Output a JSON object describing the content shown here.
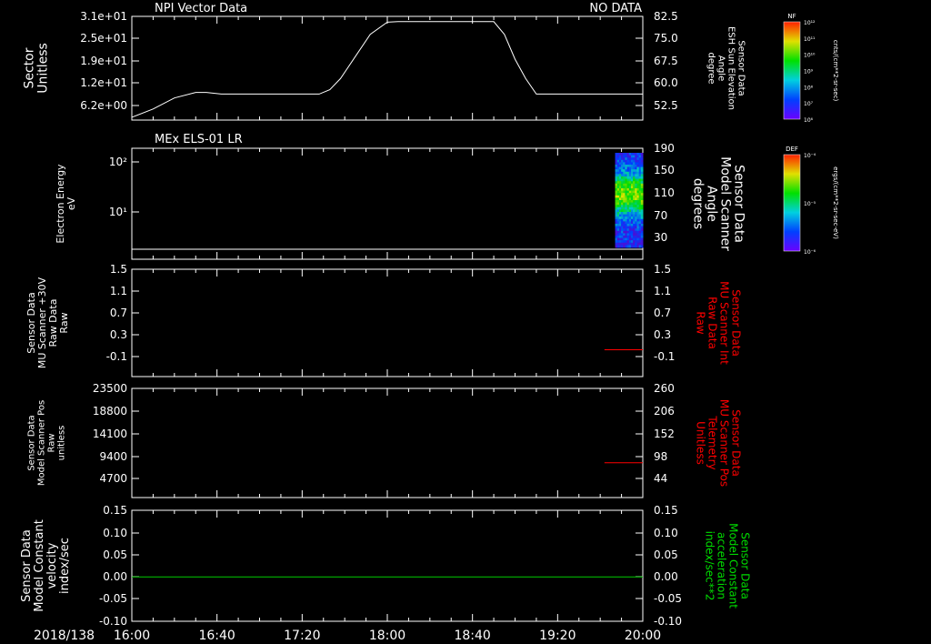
{
  "header": {
    "left_title": "NPI Vector Data",
    "right_title": "NO DATA"
  },
  "footer": {
    "date_label": "2018/138"
  },
  "colorbars": [
    {
      "label": "NF",
      "units": "cnts/(cm**2-sr-sec)",
      "ticks": [
        "10¹²",
        "10¹¹",
        "10¹⁰",
        "10⁹",
        "10⁸",
        "10⁷",
        "10⁶"
      ]
    },
    {
      "label": "DEF",
      "units": "ergs/(cm**2-sr-sec-eV)",
      "ticks": [
        "10⁻⁴",
        "10⁻⁵",
        "10⁻⁶"
      ]
    }
  ],
  "chart_data": [
    {
      "type": "line",
      "panel": 1,
      "left_ylabel": [
        "Sector",
        "Unitless"
      ],
      "left_ticks": [
        "3.1e+01",
        "2.5e+01",
        "1.9e+01",
        "1.2e+01",
        "6.2e+00"
      ],
      "right_ylabel": [
        "Sensor Data",
        "ESH Sun Elevation",
        "Angle",
        "degree"
      ],
      "right_ticks": [
        "82.5",
        "75.0",
        "67.5",
        "60.0",
        "52.5"
      ],
      "xlim": [
        0,
        240
      ],
      "ylim": [
        45,
        82.5
      ],
      "series": [
        {
          "color": "#ffffff",
          "x": [
            0,
            10,
            20,
            30,
            35,
            42,
            50,
            60,
            70,
            80,
            88,
            93,
            98,
            105,
            112,
            120,
            125,
            130,
            135,
            140,
            145,
            150,
            155,
            160,
            165,
            170,
            175,
            180,
            185,
            190,
            195,
            200,
            210,
            220,
            230,
            240
          ],
          "y": [
            46,
            49,
            53,
            55,
            55,
            54.4,
            54.4,
            54.4,
            54.4,
            54.4,
            54.4,
            56,
            60,
            68,
            76,
            80.4,
            80.6,
            80.6,
            80.6,
            80.6,
            80.6,
            80.6,
            80.6,
            80.6,
            80.6,
            80.6,
            76,
            67,
            60,
            54.4,
            54.4,
            54.4,
            54.4,
            54.4,
            54.4,
            54.4
          ]
        }
      ]
    },
    {
      "type": "heatmap",
      "panel": 2,
      "title": "MEx ELS-01 LR",
      "left_ylabel": [
        "Electron Energy",
        "eV"
      ],
      "left_ticks": [
        "10²",
        "10¹"
      ],
      "right_ylabel": [
        "Sensor Data",
        "Model Scanner",
        "Angle",
        "degrees"
      ],
      "right_ticks": [
        "190",
        "150",
        "110",
        "70",
        "30"
      ],
      "xlim": [
        0,
        240
      ],
      "data_x_range": [
        227,
        240
      ]
    },
    {
      "type": "line",
      "panel": 3,
      "left_ylabel": [
        "Sensor Data",
        "MU Scanner +30V",
        "Raw Data",
        "Raw"
      ],
      "left_ticks": [
        "1.5",
        "1.1",
        "0.7",
        "0.3",
        "-0.1"
      ],
      "right_ylabel": [
        "Sensor Data",
        "MU Scanner Int",
        "Raw Data",
        "Raw"
      ],
      "right_ticks": [
        "1.5",
        "1.1",
        "0.7",
        "0.3",
        "-0.1"
      ],
      "xlim": [
        0,
        240
      ],
      "ylim": [
        -0.5,
        1.5
      ],
      "series": [
        {
          "color": "#ff0000",
          "x": [
            222,
            240
          ],
          "y": [
            0,
            0
          ]
        }
      ]
    },
    {
      "type": "line",
      "panel": 4,
      "left_ylabel": [
        "Sensor Data",
        "Model Scanner Pos",
        "Raw",
        "unitless"
      ],
      "left_ticks": [
        "23500",
        "18800",
        "14100",
        "9400",
        "4700"
      ],
      "right_ylabel": [
        "Sensor Data",
        "MU Scanner Pos",
        "Telemetry",
        "Unitless"
      ],
      "right_ticks": [
        "260",
        "206",
        "152",
        "98",
        "44"
      ],
      "xlim": [
        0,
        240
      ],
      "ylim": [
        0,
        23500
      ],
      "series": [
        {
          "color": "#ff0000",
          "x": [
            222,
            240
          ],
          "y": [
            7500,
            7500
          ]
        }
      ]
    },
    {
      "type": "line",
      "panel": 5,
      "left_ylabel": [
        "Sensor Data",
        "Model Constant",
        "velocity",
        "index/sec"
      ],
      "left_ticks": [
        "0.15",
        "0.10",
        "0.05",
        "0.00",
        "-0.05",
        "-0.10"
      ],
      "right_ylabel": [
        "Sensor Data",
        "Model Constant",
        "acceleration",
        "index/sec**2"
      ],
      "right_ticks": [
        "0.15",
        "0.10",
        "0.05",
        "0.00",
        "-0.05",
        "-0.10"
      ],
      "xlim": [
        0,
        240
      ],
      "ylim": [
        -0.1,
        0.15
      ],
      "series": [
        {
          "color": "#00cc00",
          "x": [
            0,
            240
          ],
          "y": [
            0,
            0
          ]
        }
      ]
    }
  ],
  "x_axis": {
    "tick_labels": [
      "16:00",
      "16:40",
      "17:20",
      "18:00",
      "18:40",
      "19:20",
      "20:00"
    ],
    "tick_minutes": [
      0,
      40,
      80,
      120,
      160,
      200,
      240
    ]
  }
}
